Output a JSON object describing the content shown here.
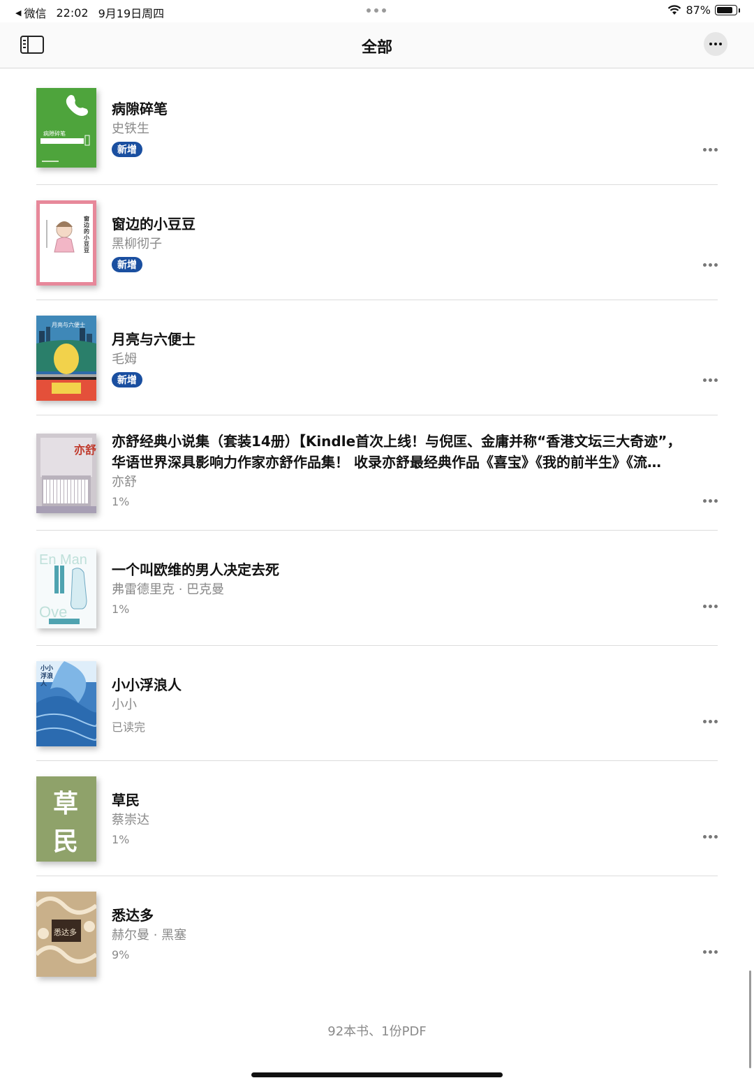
{
  "status_bar": {
    "back_app": "微信",
    "time": "22:02",
    "date": "9月19日周四",
    "battery": "87%"
  },
  "navbar": {
    "title": "全部"
  },
  "books": [
    {
      "title": "病隙碎笔",
      "author": "史铁生",
      "badge": "新增",
      "progress": ""
    },
    {
      "title": "窗边的小豆豆",
      "author": "黑柳彻子",
      "badge": "新增",
      "progress": ""
    },
    {
      "title": "月亮与六便士",
      "author": "毛姆",
      "badge": "新增",
      "progress": ""
    },
    {
      "title": "亦舒经典小说集（套装14册）【Kindle首次上线！与倪匡、金庸并称“香港文坛三大奇迹”，华语世界深具影响力作家亦舒作品集！ 收录亦舒最经典作品《喜宝》《我的前半生》《流…",
      "author": "亦舒",
      "badge": "",
      "progress": "1%"
    },
    {
      "title": "一个叫欧维的男人决定去死",
      "author": "弗雷德里克 · 巴克曼",
      "badge": "",
      "progress": "1%"
    },
    {
      "title": "小小浮浪人",
      "author": "小小",
      "badge": "",
      "progress": "已读完"
    },
    {
      "title": "草民",
      "author": "蔡崇达",
      "badge": "",
      "progress": "1%"
    },
    {
      "title": "悉达多",
      "author": "赫尔曼 · 黑塞",
      "badge": "",
      "progress": "9%"
    }
  ],
  "cover_text": {
    "book1": "病隙碎笔",
    "book2": "窗边的小豆豆",
    "book3": "月亮与六便士",
    "book4": "亦舒",
    "book6": "小小浮浪人",
    "book7_a": "草",
    "book7_b": "民",
    "book8": "悉达多"
  },
  "footer": {
    "count": "92本书、1份PDF"
  },
  "colors": {
    "badge": "#1a4fa0",
    "cover_green": "#4ea43c",
    "cover_pink": "#e7889a",
    "cover_blue": "#2e6aa8",
    "cover_olive": "#8fa26a"
  }
}
